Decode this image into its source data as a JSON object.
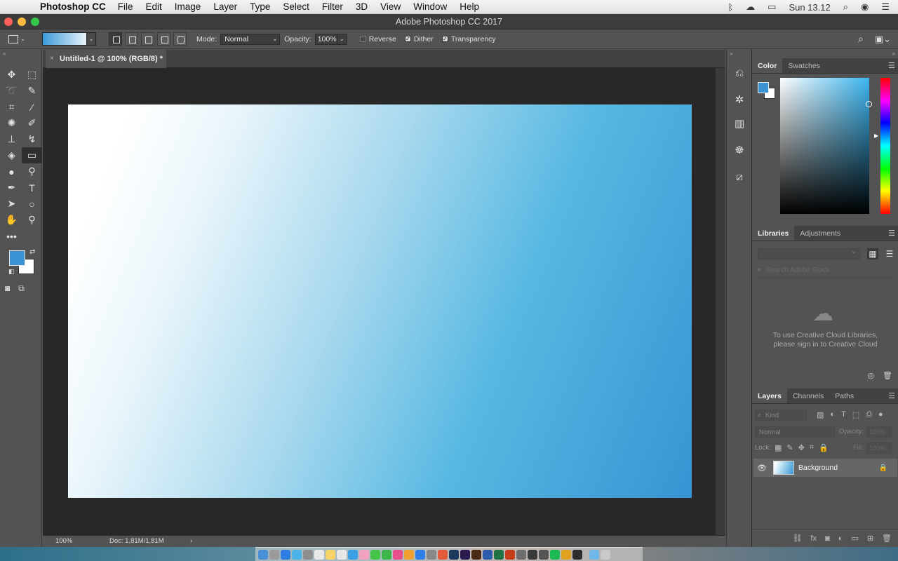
{
  "menubar": {
    "app_name": "Photoshop CC",
    "items": [
      "File",
      "Edit",
      "Image",
      "Layer",
      "Type",
      "Select",
      "Filter",
      "3D",
      "View",
      "Window",
      "Help"
    ],
    "clock": "Sun 13.12"
  },
  "window": {
    "title": "Adobe Photoshop CC 2017"
  },
  "options": {
    "mode_label": "Mode:",
    "mode_value": "Normal",
    "opacity_label": "Opacity:",
    "opacity_value": "100%",
    "reverse_label": "Reverse",
    "reverse_checked": false,
    "dither_label": "Dither",
    "dither_checked": true,
    "transparency_label": "Transparency",
    "transparency_checked": true,
    "gradient_colors": [
      "#3b9ad8",
      "#e8f4fb"
    ]
  },
  "tools": {
    "foreground_color": "#3b93d4",
    "background_color": "#ffffff",
    "selected": "gradient-tool",
    "more_label": "•••"
  },
  "document": {
    "tab_title": "Untitled-1 @ 100% (RGB/8) *",
    "close_glyph": "×",
    "zoom": "100%",
    "doc_size": "Doc: 1,81M/1,81M",
    "status_arrow": "›",
    "gradient_colors": [
      "#ffffff",
      "#3794d3"
    ]
  },
  "color_panel": {
    "tabs": [
      "Color",
      "Swatches"
    ]
  },
  "libraries_panel": {
    "tabs": [
      "Libraries",
      "Adjustments"
    ],
    "search_placeholder": "Search Adobe Stock",
    "message_line1": "To use Creative Cloud Libraries,",
    "message_line2": "please sign in to Creative Cloud"
  },
  "layers_panel": {
    "tabs": [
      "Layers",
      "Channels",
      "Paths"
    ],
    "kind_label": "Kind",
    "blend_mode": "Normal",
    "opacity_label": "Opacity:",
    "opacity_value": "100%",
    "lock_label": "Lock:",
    "fill_label": "Fill:",
    "fill_value": "100%",
    "layers": [
      {
        "name": "Background",
        "visible": true,
        "locked": true
      }
    ]
  }
}
